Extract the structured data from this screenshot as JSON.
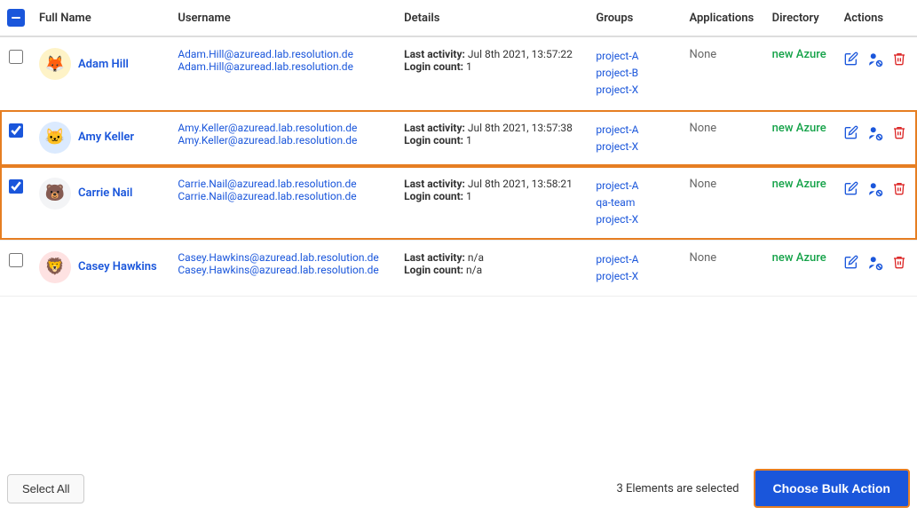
{
  "header": {
    "checkbox_state": "indeterminate",
    "columns": {
      "full_name": "Full Name",
      "username": "Username",
      "details": "Details",
      "groups": "Groups",
      "applications": "Applications",
      "directory": "Directory",
      "actions": "Actions"
    }
  },
  "users": [
    {
      "id": 1,
      "checked": false,
      "highlight": false,
      "avatar_emoji": "🦊",
      "avatar_class": "avatar-1",
      "full_name": "Adam Hill",
      "email1": "Adam.Hill@azuread.lab.resolution.de",
      "email2": "Adam.Hill@azuread.lab.resolution.de",
      "last_activity": "Jul 8th 2021, 13:57:22",
      "login_count": "1",
      "groups": [
        "project-A",
        "project-B",
        "project-X"
      ],
      "applications": "None",
      "directory": "new Azure"
    },
    {
      "id": 2,
      "checked": true,
      "highlight": true,
      "avatar_emoji": "🐱",
      "avatar_class": "avatar-2",
      "full_name": "Amy Keller",
      "email1": "Amy.Keller@azuread.lab.resolution.de",
      "email2": "Amy.Keller@azuread.lab.resolution.de",
      "last_activity": "Jul 8th 2021, 13:57:38",
      "login_count": "1",
      "groups": [
        "project-A",
        "project-X"
      ],
      "applications": "None",
      "directory": "new Azure"
    },
    {
      "id": 3,
      "checked": true,
      "highlight": true,
      "avatar_emoji": "🐻",
      "avatar_class": "avatar-3",
      "full_name": "Carrie Nail",
      "email1": "Carrie.Nail@azuread.lab.resolution.de",
      "email2": "Carrie.Nail@azuread.lab.resolution.de",
      "last_activity": "Jul 8th 2021, 13:58:21",
      "login_count": "1",
      "groups": [
        "project-A",
        "qa-team",
        "project-X"
      ],
      "applications": "None",
      "directory": "new Azure"
    },
    {
      "id": 4,
      "checked": false,
      "highlight": false,
      "avatar_emoji": "🦁",
      "avatar_class": "avatar-4",
      "full_name": "Casey Hawkins",
      "email1": "Casey.Hawkins@azuread.lab.resolution.de",
      "email2": "Casey.Hawkins@azuread.lab.resolution.de",
      "last_activity": "n/a",
      "login_count": "n/a",
      "groups": [
        "project-A",
        "project-X"
      ],
      "applications": "None",
      "directory": "new Azure"
    }
  ],
  "footer": {
    "select_all_label": "Select All",
    "elements_count": "3 Elements are selected",
    "bulk_action_label": "Choose Bulk Action"
  },
  "icons": {
    "edit": "✏️",
    "user_block": "👤",
    "delete": "🗑️"
  }
}
